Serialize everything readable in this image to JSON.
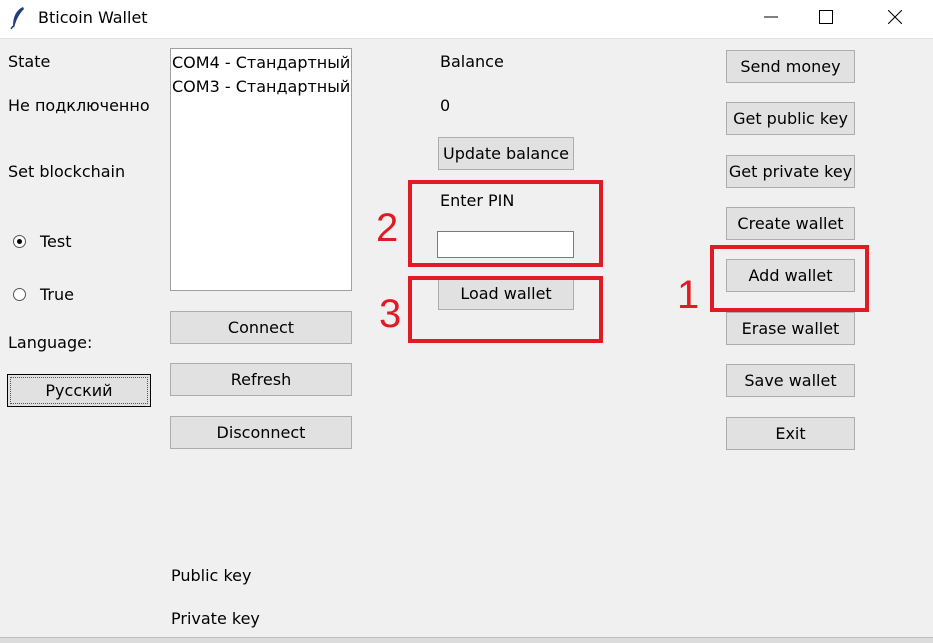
{
  "window": {
    "title": "Bticoin Wallet",
    "icons": {
      "app": "feather-icon",
      "minimize": "minimize-icon",
      "maximize": "maximize-icon",
      "close": "close-icon"
    }
  },
  "left": {
    "state_label": "State",
    "state_value": "Не подключенно",
    "blockchain_label": "Set blockchain",
    "radio_test": "Test",
    "radio_true": "True",
    "selected_chain": "Test",
    "language_label": "Language:",
    "language_button": "Русский"
  },
  "ports": {
    "items": [
      "COM4 - Стандартный",
      "COM3 - Стандартный"
    ],
    "connect": "Connect",
    "refresh": "Refresh",
    "disconnect": "Disconnect"
  },
  "keys": {
    "public": "Public key",
    "private": "Private key"
  },
  "center": {
    "balance_label": "Balance",
    "balance_value": "0",
    "update_balance": "Update balance",
    "pin_label": "Enter PIN",
    "pin_value": "",
    "load_wallet": "Load wallet"
  },
  "actions": {
    "send_money": "Send money",
    "get_public_key": "Get public key",
    "get_private_key": "Get private key",
    "create_wallet": "Create wallet",
    "add_wallet": "Add wallet",
    "erase_wallet": "Erase wallet",
    "save_wallet": "Save wallet",
    "exit": "Exit"
  },
  "annotations": {
    "color": "#e01b24",
    "step1": "1",
    "step2": "2",
    "step3": "3"
  }
}
